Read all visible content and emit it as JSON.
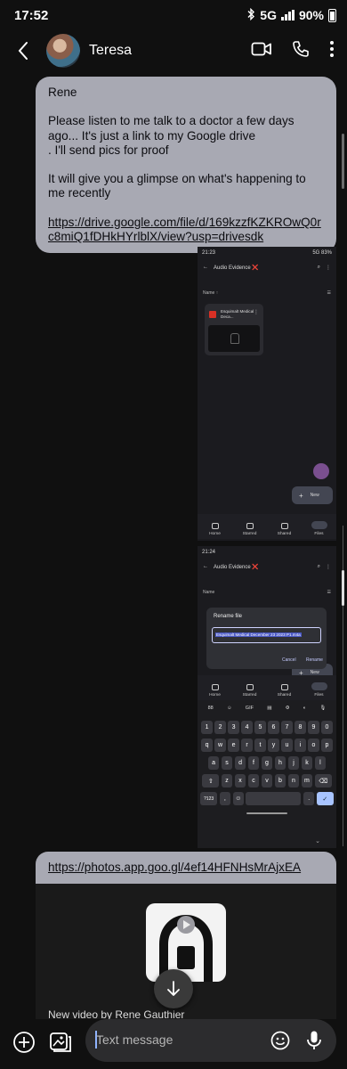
{
  "status_bar": {
    "time": "17:52",
    "network": "5G",
    "battery": "90%"
  },
  "header": {
    "contact_name": "Teresa"
  },
  "message": {
    "greeting": "Rene",
    "body1": "Please listen to me talk to a doctor a few days ago... It's just a link to my Google drive",
    "body2": ". I'll send pics for proof",
    "body3": "It will give you a glimpse on what's happening to me recently",
    "link": "https://drive.google.com/file/d/169kzzfKZKROwQ0rc8miQ1fDHkHYrlblX/view?usp=drivesdk"
  },
  "screenshot1": {
    "time": "21:23",
    "status_right": "5G 83%",
    "folder_title": "Audio Evidence ❌",
    "sort_label": "Name ↑",
    "file_name": "Esquimalt Medical Deca...",
    "new_label": "New",
    "nav": [
      "Home",
      "Starred",
      "Shared",
      "Files"
    ]
  },
  "screenshot2": {
    "time": "21:24",
    "folder_title": "Audio Evidence ❌",
    "sort_label": "Name",
    "dialog_title": "Rename file",
    "rename_value": "Esquimalt Medical December 23 2023 P1.m4a",
    "cancel_label": "Cancel",
    "rename_label": "Rename",
    "new_label": "New",
    "nav": [
      "Home",
      "Starred",
      "Shared",
      "Files"
    ],
    "keyboard_toolbar": [
      "88",
      "☺",
      "GIF",
      "▤",
      "⚙",
      "◐",
      "🎙"
    ],
    "keys_row1": [
      "1",
      "2",
      "3",
      "4",
      "5",
      "6",
      "7",
      "8",
      "9",
      "0"
    ],
    "keys_row2": [
      "q",
      "w",
      "e",
      "r",
      "t",
      "y",
      "u",
      "i",
      "o",
      "p"
    ],
    "keys_row3": [
      "a",
      "s",
      "d",
      "f",
      "g",
      "h",
      "j",
      "k",
      "l"
    ],
    "keys_row4": [
      "⇧",
      "z",
      "x",
      "c",
      "v",
      "b",
      "n",
      "m",
      "⌫"
    ],
    "keys_row5": [
      "?123",
      ",",
      "☺",
      "",
      ".",
      "✓"
    ]
  },
  "link_card": {
    "url": "https://photos.app.goo.gl/4ef14HFNHsMrAjxEA",
    "title": "New video by Rene Gauthier"
  },
  "compose": {
    "placeholder": "Text message"
  },
  "icons": {
    "back": "back-arrow-icon",
    "video_call": "video-camera-icon",
    "phone": "phone-icon",
    "more": "more-vertical-icon",
    "download": "download-arrow-icon",
    "add": "plus-circle-icon",
    "gallery": "gallery-icon",
    "emoji": "emoji-icon",
    "mic": "microphone-icon"
  }
}
